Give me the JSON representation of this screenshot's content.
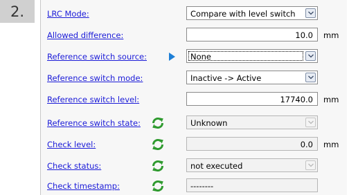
{
  "step": {
    "number": "2."
  },
  "rows": [
    {
      "label": "LRC Mode:",
      "value": "Compare with level switch",
      "unit": "",
      "kind": "select",
      "state": "enabled"
    },
    {
      "label": "Allowed difference:",
      "value": "10.0",
      "unit": "mm",
      "kind": "numeric",
      "state": "enabled"
    },
    {
      "label": "Reference switch source:",
      "value": "None",
      "unit": "",
      "kind": "select",
      "state": "focused"
    },
    {
      "label": "Reference switch mode:",
      "value": "Inactive -> Active",
      "unit": "",
      "kind": "select",
      "state": "enabled"
    },
    {
      "label": "Reference switch level:",
      "value": "17740.0",
      "unit": "mm",
      "kind": "numeric",
      "state": "enabled"
    },
    {
      "label": "Reference switch state:",
      "value": "Unknown",
      "unit": "",
      "kind": "select",
      "state": "disabled"
    },
    {
      "label": "Check level:",
      "value": "0.0",
      "unit": "mm",
      "kind": "numeric",
      "state": "disabled"
    },
    {
      "label": "Check status:",
      "value": "not executed",
      "unit": "",
      "kind": "select",
      "state": "disabled"
    },
    {
      "label": "Check timestamp:",
      "value": "--------",
      "unit": "",
      "kind": "text",
      "state": "disabled"
    }
  ],
  "icons": {
    "refresh": "refresh-icon",
    "pointer": "pointer-arrow-icon",
    "dropdown": "chevron-down-icon"
  },
  "colors": {
    "link": "#1b1bd8",
    "refresh_green": "#2e9a2e",
    "pointer_blue": "#1e7fd6"
  }
}
